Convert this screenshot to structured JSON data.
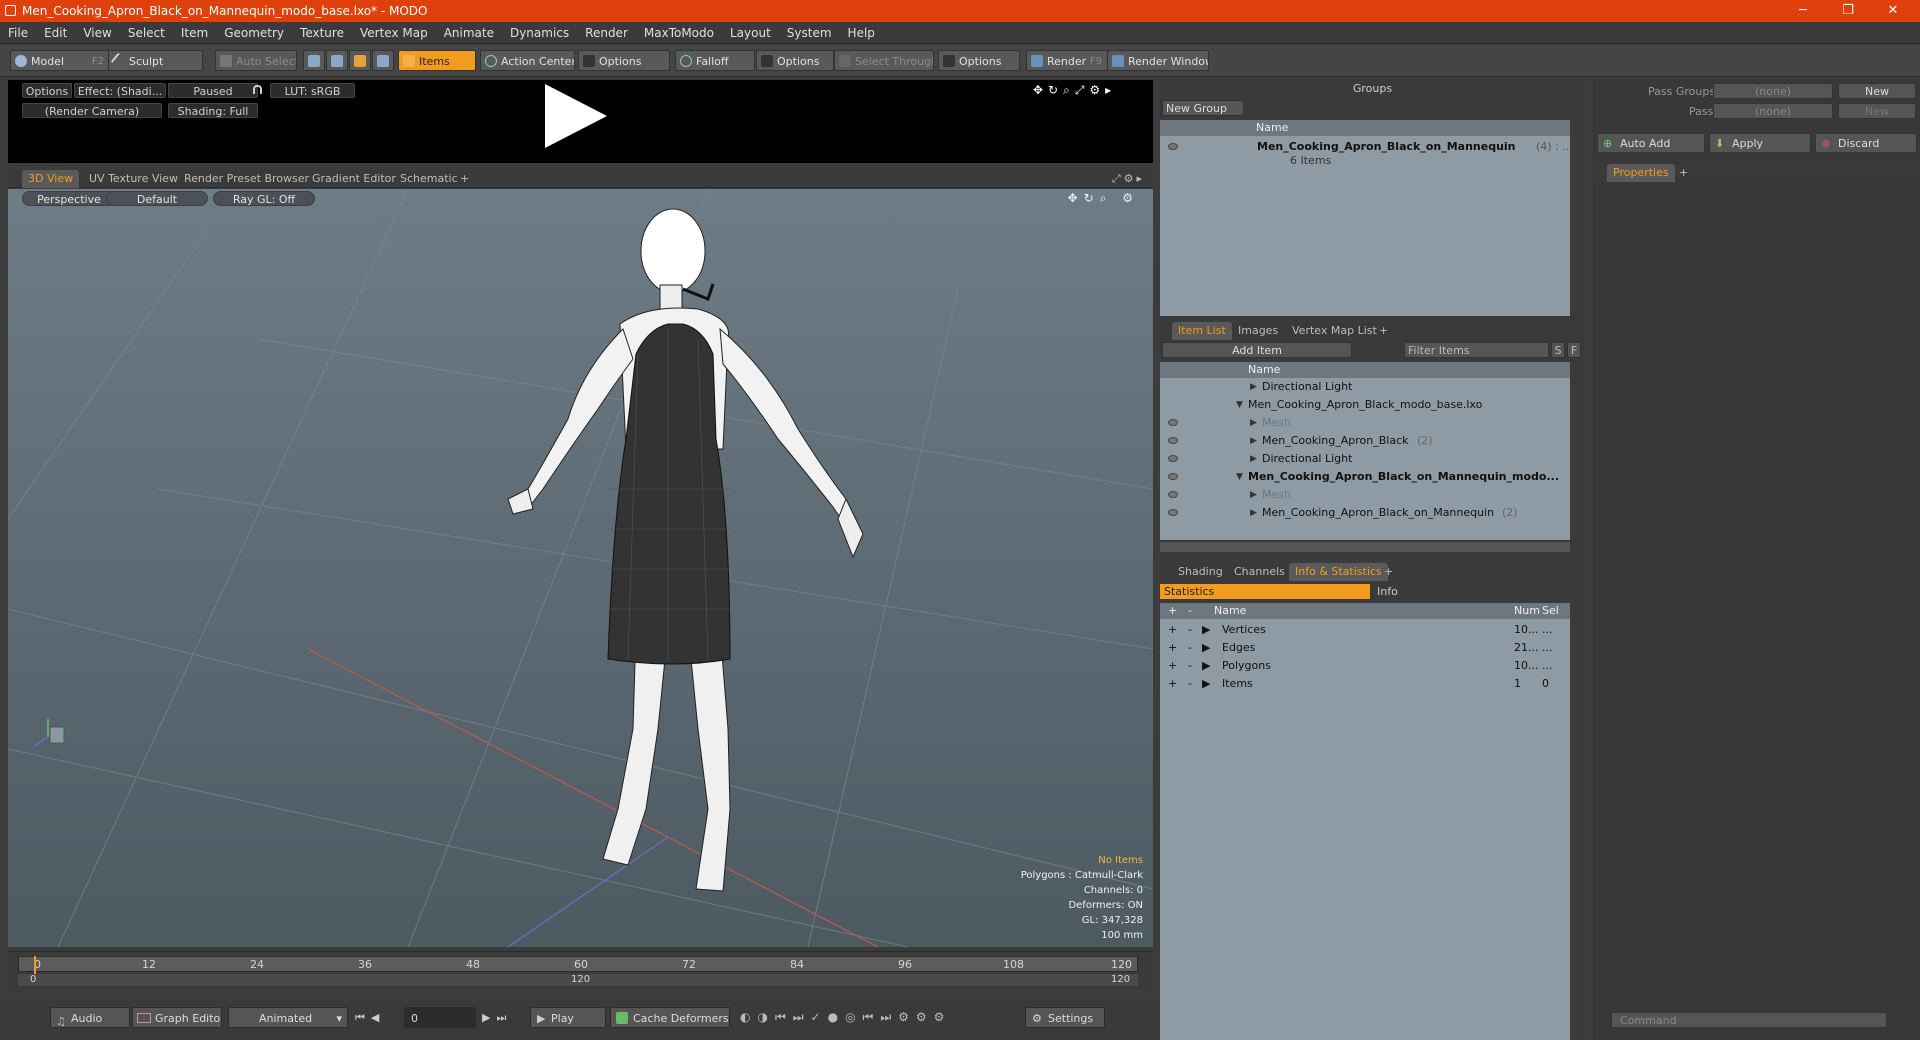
{
  "window": {
    "title": "Men_Cooking_Apron_Black_on_Mannequin_modo_base.lxo* - MODO",
    "min": "─",
    "max": "❐",
    "close": "✕"
  },
  "menu": [
    "File",
    "Edit",
    "View",
    "Select",
    "Item",
    "Geometry",
    "Texture",
    "Vertex Map",
    "Animate",
    "Dynamics",
    "Render",
    "MaxToModo",
    "Layout",
    "System",
    "Help"
  ],
  "toolbar": {
    "model": "Model",
    "model_key": "F2",
    "sculpt": "Sculpt",
    "auto_select": "Auto Select",
    "items": "Items",
    "action_center": "Action Center",
    "options1": "Options",
    "falloff": "Falloff",
    "options2": "Options",
    "select_through": "Select Through",
    "options3": "Options",
    "render": "Render",
    "render_key": "F9",
    "render_window": "Render Window"
  },
  "preview": {
    "options": "Options",
    "effect": "Effect: (Shadi...",
    "paused": "Paused",
    "lut": "LUT: sRGB",
    "camera": "(Render Camera)",
    "shading": "Shading: Full"
  },
  "view_tabs": [
    "3D View",
    "UV Texture View",
    "Render Preset Browser",
    "Gradient Editor",
    "Schematic",
    "+"
  ],
  "viewport": {
    "projection": "Perspective",
    "style": "Default",
    "raygl": "Ray GL: Off"
  },
  "stats": {
    "items": "No Items",
    "polygons": "Polygons : Catmull-Clark",
    "channels": "Channels: 0",
    "deformers": "Deformers: ON",
    "gl": "GL: 347,328",
    "scale": "100 mm"
  },
  "timeline": {
    "ticks": [
      "0",
      "12",
      "24",
      "36",
      "48",
      "60",
      "72",
      "84",
      "96",
      "108",
      "120"
    ],
    "range_start": "0",
    "range_mid": "120",
    "range_end": "120"
  },
  "bottom": {
    "audio": "Audio",
    "graph_editor": "Graph Editor",
    "animated": "Animated",
    "frame": "0",
    "play": "Play",
    "cache": "Cache Deformers",
    "settings": "Settings"
  },
  "groups": {
    "title": "Groups",
    "new_group": "New Group",
    "col_name": "Name",
    "item_name": "Men_Cooking_Apron_Black_on_Mannequin",
    "item_count": "(4) : ...",
    "item_sub": "6 Items"
  },
  "pass": {
    "pass_groups": "Pass Groups",
    "passes": "Passes",
    "none1": "(none)",
    "none2": "(none)",
    "new1": "New",
    "new2": "New",
    "auto_add": "Auto Add",
    "apply": "Apply",
    "discard": "Discard",
    "properties": "Properties",
    "plus": "+"
  },
  "item_list": {
    "tabs": [
      "Item List",
      "Images",
      "Vertex Map List",
      "+"
    ],
    "add_item": "Add Item",
    "filter": "Filter Items",
    "s": "S",
    "f": "F",
    "col_name": "Name",
    "rows": [
      {
        "label": "Directional Light",
        "extra": "",
        "indent": 2,
        "bold": false,
        "dim": false,
        "eye": false
      },
      {
        "label": "Men_Cooking_Apron_Black_modo_base.lxo",
        "extra": "",
        "indent": 1,
        "bold": false,
        "dim": false,
        "eye": false
      },
      {
        "label": "Mesh",
        "extra": "",
        "indent": 2,
        "bold": false,
        "dim": true,
        "eye": true
      },
      {
        "label": "Men_Cooking_Apron_Black",
        "extra": "(2)",
        "indent": 2,
        "bold": false,
        "dim": false,
        "eye": true
      },
      {
        "label": "Directional Light",
        "extra": "",
        "indent": 2,
        "bold": false,
        "dim": false,
        "eye": true
      },
      {
        "label": "Men_Cooking_Apron_Black_on_Mannequin_modo...",
        "extra": "",
        "indent": 1,
        "bold": true,
        "dim": false,
        "eye": true
      },
      {
        "label": "Mesh",
        "extra": "",
        "indent": 2,
        "bold": false,
        "dim": true,
        "eye": true
      },
      {
        "label": "Men_Cooking_Apron_Black_on_Mannequin",
        "extra": "(2)",
        "indent": 2,
        "bold": false,
        "dim": false,
        "eye": true
      }
    ]
  },
  "info": {
    "tabs": [
      "Shading",
      "Channels",
      "Info & Statistics",
      "+"
    ],
    "statistics": "Statistics",
    "info": "Info",
    "col_name": "Name",
    "col_num": "Num",
    "col_sel": "Sel",
    "rows": [
      {
        "name": "Vertices",
        "num": "10...",
        "sel": "..."
      },
      {
        "name": "Edges",
        "num": "21...",
        "sel": "..."
      },
      {
        "name": "Polygons",
        "num": "10...",
        "sel": "..."
      },
      {
        "name": "Items",
        "num": "1",
        "sel": "0"
      }
    ]
  },
  "command": {
    "placeholder": "Command"
  }
}
